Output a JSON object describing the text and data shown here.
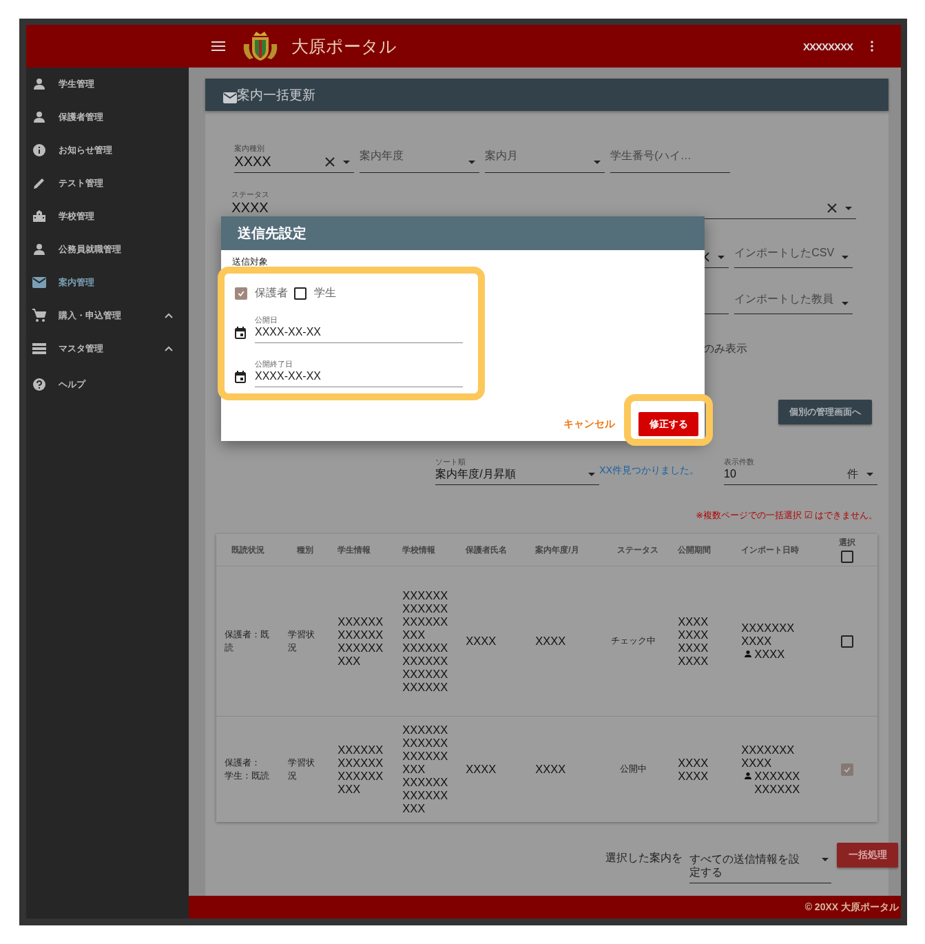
{
  "header": {
    "title": "大原ポータル",
    "user": "XXXXXXXX"
  },
  "sidebar": {
    "items": [
      {
        "label": "学生管理",
        "kind": "person",
        "selected": false,
        "submenu": false
      },
      {
        "label": "保護者管理",
        "kind": "person",
        "selected": false,
        "submenu": false
      },
      {
        "label": "お知らせ管理",
        "kind": "info",
        "selected": false,
        "submenu": false
      },
      {
        "label": "テスト管理",
        "kind": "pencil",
        "selected": false,
        "submenu": false
      },
      {
        "label": "学校管理",
        "kind": "building",
        "selected": false,
        "submenu": false
      },
      {
        "label": "公務員就職管理",
        "kind": "person",
        "selected": false,
        "submenu": false
      },
      {
        "label": "案内管理",
        "kind": "mail",
        "selected": true,
        "submenu": false
      },
      {
        "label": "購入・申込管理",
        "kind": "cart",
        "selected": false,
        "submenu": true
      },
      {
        "label": "マスタ管理",
        "kind": "list",
        "selected": false,
        "submenu": true
      },
      {
        "label": "ヘルプ",
        "kind": "help",
        "selected": false,
        "submenu": false
      }
    ]
  },
  "page": {
    "title": "案内一括更新"
  },
  "filters": {
    "rows": [
      [
        {
          "label": "案内種別",
          "value": "XXXX",
          "clearable": true,
          "dropdown": true
        },
        {
          "placeholder": "案内年度",
          "clearable": false,
          "dropdown": true
        },
        {
          "placeholder": "案内月",
          "clearable": false,
          "dropdown": true
        },
        {
          "placeholder": "学生番号(ハイ…",
          "clearable": false,
          "dropdown": false
        }
      ],
      [
        {
          "label": "ステータス",
          "value": "XXXX",
          "clearable": true,
          "dropdown": true
        }
      ],
      [
        {
          "clearable": true,
          "dropdown": true
        },
        {
          "placeholder": "インポートしたCSV",
          "clearable": false,
          "dropdown": true
        }
      ],
      [
        {
          "clearable": false,
          "dropdown": false
        },
        {
          "placeholder": "インポートした教員",
          "clearable": false,
          "dropdown": true
        }
      ]
    ],
    "checkbox_label": "のみ表示"
  },
  "manage_button": "個別の管理画面へ",
  "sort": {
    "label": "ソート順",
    "value": "案内年度/月昇順"
  },
  "result_count": "XX件見つかりました。",
  "per_page": {
    "label": "表示件数",
    "value": "10",
    "suffix": "件"
  },
  "notice": "※複数ページでの一括選択 ☑ はできません。",
  "table": {
    "columns": [
      "既読状況",
      "種別",
      "学生情報",
      "学校情報",
      "保護者氏名",
      "案内年度/月",
      "ステータス",
      "公開期間",
      "インポート日時",
      "選択"
    ],
    "select_all": false,
    "rows": [
      {
        "read_status": [
          "保護者：既読"
        ],
        "type": "学習状況",
        "student_info": "XXXXXXXXXXXXXXXXXXXXX",
        "school_info": [
          "XXXXXXXXXXXXXXXXXXXXX",
          "XXXXXXXXXXXXXXXXXXXXXXXX"
        ],
        "guardian": "XXXX",
        "year_month": "XXXX",
        "status": "チェック中",
        "period": [
          "XXXX",
          "XXXX",
          "XXXX",
          "XXXX"
        ],
        "import_date": [
          "XXXXXXX",
          "XXXX"
        ],
        "importer": "XXXX",
        "selected": false
      },
      {
        "read_status": [
          "保護者：",
          "学生：既読"
        ],
        "type": "学習状況",
        "student_info": "XXXXXXXXXXXXXXXXXXXXX",
        "school_info": [
          "XXXXXXXXXXXXXXXXXXXXX",
          "XXXXXXXXXXXXXXX"
        ],
        "guardian": "XXXX",
        "year_month": "XXXX",
        "status": "公開中",
        "period": [
          "XXXX",
          "XXXX"
        ],
        "import_date": [
          "XXXXXXX",
          "XXXX"
        ],
        "importer": "XXXXXXXXXXXX",
        "selected": true
      }
    ]
  },
  "bulk": {
    "label": "選択した案内を",
    "value": "すべての送信情報を設定する",
    "button": "一括処理"
  },
  "footer": "© 20XX 大原ポータル",
  "dialog": {
    "title": "送信先設定",
    "section_label": "送信対象",
    "targets": [
      {
        "label": "保護者",
        "checked": true
      },
      {
        "label": "学生",
        "checked": false
      }
    ],
    "dates": [
      {
        "label": "公開日",
        "value": "XXXX-XX-XX"
      },
      {
        "label": "公開終了日",
        "value": "XXXX-XX-XX"
      }
    ],
    "cancel": "キャンセル",
    "confirm": "修正する"
  }
}
